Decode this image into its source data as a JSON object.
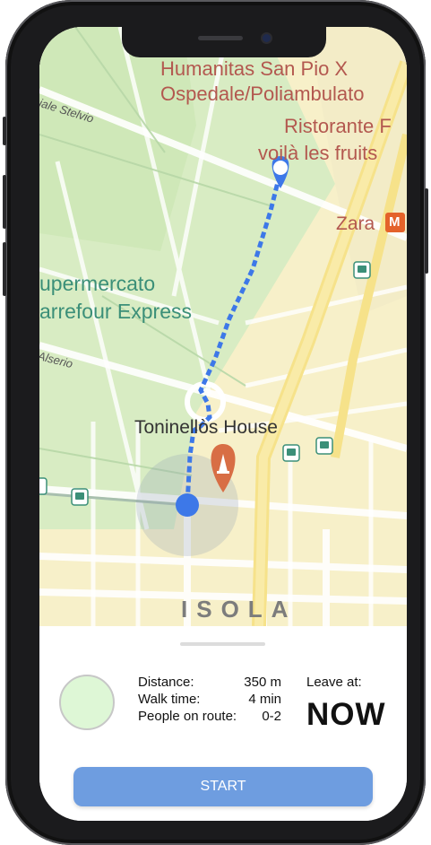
{
  "map": {
    "poi_labels": {
      "hospital_line1": "Humanitas San Pio X",
      "hospital_line2": "Ospedale/Poliambulato",
      "restaurant": "Ristorante F",
      "fruits": "voilà les fruits",
      "zara": "Zara",
      "supermarket_line1": "upermercato",
      "supermarket_line2": "arrefour Express",
      "destination": "Toninellòs House"
    },
    "streets": {
      "stelvio": "iale Stelvio",
      "alserio": "Alserio"
    },
    "district": "ISOLA",
    "metro_badge": "M",
    "colors": {
      "route": "#3d78e8",
      "start_dot": "#3d78e8",
      "destination_pin": "#d86e45"
    }
  },
  "sheet": {
    "distance_label": "Distance:",
    "distance_value": "350 m",
    "walk_label": "Walk time:",
    "walk_value": "4 min",
    "people_label": "People on route:",
    "people_value": "0-2",
    "leave_label": "Leave at:",
    "leave_value": "NOW",
    "start_label": "START"
  }
}
